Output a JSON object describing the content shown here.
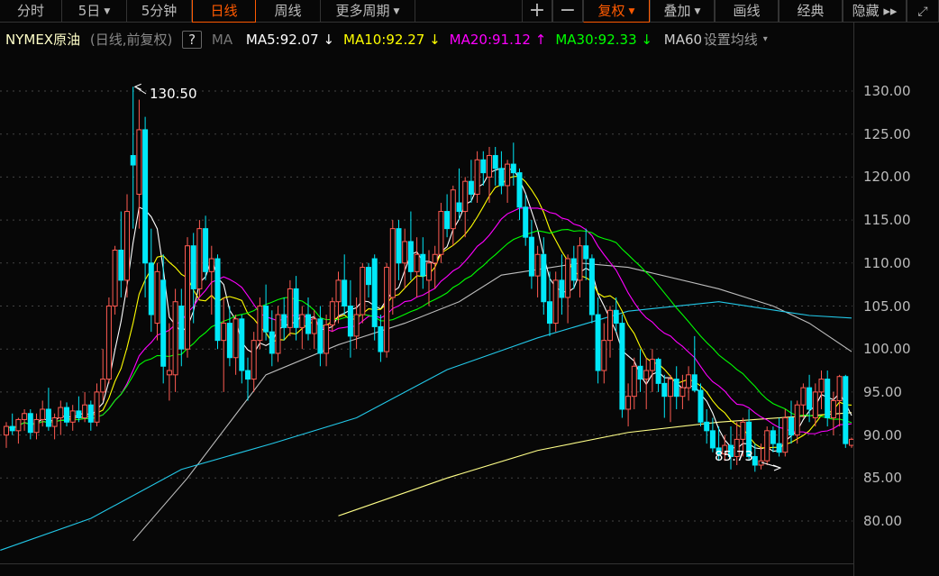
{
  "toolbar": {
    "left": [
      {
        "label": "分时"
      },
      {
        "label": "5日",
        "dropdown": true
      },
      {
        "label": "5分钟"
      },
      {
        "label": "日线",
        "active": true
      },
      {
        "label": "周线"
      },
      {
        "label": "更多周期",
        "dropdown": true
      }
    ],
    "zoom_in": "+",
    "zoom_out": "−",
    "right": [
      {
        "label": "复权",
        "dropdown": true,
        "active": true
      },
      {
        "label": "叠加",
        "dropdown": true
      },
      {
        "label": "画线"
      },
      {
        "label": "经典"
      },
      {
        "label": "隐藏 ▸▸"
      }
    ],
    "fullscreen_icon": "expand-icon"
  },
  "legend": {
    "symbol": "NYMEX原油",
    "period": "(日线,前复权)",
    "help": "?",
    "ma_label": "MA",
    "ma": [
      {
        "label": "MA5:92.07",
        "arrow": "↓",
        "color": "#ffffff"
      },
      {
        "label": "MA10:92.27",
        "arrow": "↓",
        "color": "#ffff00"
      },
      {
        "label": "MA20:91.12",
        "arrow": "↑",
        "color": "#ff00ff"
      },
      {
        "label": "MA30:92.33",
        "arrow": "↓",
        "color": "#00ff00"
      }
    ],
    "ma60": "MA60",
    "settings": "设置均线",
    "settings_arrow": "▾"
  },
  "colors": {
    "up": "#ff5b52",
    "down": "#00e8f8",
    "accent": "#ff5a00"
  },
  "chart_data": {
    "type": "candlestick",
    "ylim": [
      75,
      135
    ],
    "yticks": [
      "130.00",
      "125.00",
      "120.00",
      "115.00",
      "110.00",
      "105.00",
      "100.00",
      "95.00",
      "90.00",
      "85.00",
      "80.00"
    ],
    "annotations": {
      "high": "130.50",
      "low": "85.73"
    },
    "candles": [
      [
        90,
        91.5,
        88.5,
        91
      ],
      [
        91,
        92.5,
        90,
        90.5
      ],
      [
        90.5,
        92,
        89,
        91.8
      ],
      [
        91.8,
        93,
        90.5,
        92.5
      ],
      [
        92.5,
        93,
        89.5,
        90.3
      ],
      [
        90.3,
        92.5,
        89.5,
        91.8
      ],
      [
        91.8,
        94,
        91,
        93
      ],
      [
        93,
        95.5,
        90.5,
        91
      ],
      [
        91,
        92.5,
        89.5,
        92
      ],
      [
        92,
        94,
        90,
        93.2
      ],
      [
        93.2,
        93.8,
        91,
        91.5
      ],
      [
        91.5,
        93.5,
        90.5,
        92.8
      ],
      [
        92.8,
        94.5,
        91.5,
        92
      ],
      [
        92,
        95,
        91.5,
        93.5
      ],
      [
        93.5,
        94,
        90.5,
        91.5
      ],
      [
        91.5,
        96,
        91,
        95
      ],
      [
        95,
        100,
        94,
        96.5
      ],
      [
        96.5,
        106,
        96,
        105
      ],
      [
        105,
        112,
        104,
        111.5
      ],
      [
        111.5,
        116,
        106,
        108
      ],
      [
        108,
        118,
        106,
        116
      ],
      [
        122.5,
        130.5,
        114,
        121.4
      ],
      [
        118,
        129,
        114,
        125.5
      ],
      [
        125.5,
        127,
        106,
        110
      ],
      [
        110,
        114,
        102,
        104
      ],
      [
        103,
        110,
        101,
        109
      ],
      [
        108,
        111,
        96,
        98
      ],
      [
        97,
        103,
        94,
        97.5
      ],
      [
        97,
        107,
        95,
        105.5
      ],
      [
        105,
        107,
        98,
        100
      ],
      [
        100,
        113,
        99,
        112
      ],
      [
        112,
        113.5,
        103,
        107
      ],
      [
        107,
        115,
        106,
        114
      ],
      [
        114,
        115.5,
        108,
        109
      ],
      [
        109,
        112,
        104,
        110.5
      ],
      [
        110.5,
        111,
        100,
        101
      ],
      [
        101,
        106,
        95,
        103
      ],
      [
        103,
        105,
        98,
        99
      ],
      [
        99,
        104,
        97,
        103.5
      ],
      [
        103.5,
        104,
        96,
        97.5
      ],
      [
        97.5,
        99,
        94,
        96.5
      ],
      [
        96.5,
        102,
        95,
        101
      ],
      [
        101,
        106,
        100,
        105
      ],
      [
        105,
        107.5,
        101,
        102
      ],
      [
        102,
        104.5,
        98,
        99.5
      ],
      [
        99.5,
        105,
        98.5,
        104
      ],
      [
        104,
        106,
        101,
        102.5
      ],
      [
        102.5,
        108,
        101.5,
        107
      ],
      [
        107,
        108.5,
        101,
        102.5
      ],
      [
        102.5,
        105,
        100,
        104
      ],
      [
        104,
        106,
        101,
        101.8
      ],
      [
        101.8,
        104.5,
        100,
        103.5
      ],
      [
        103.5,
        105,
        98,
        99.5
      ],
      [
        99.5,
        104,
        98,
        102.8
      ],
      [
        102.8,
        106,
        102,
        105.5
      ],
      [
        105.5,
        109,
        103,
        108
      ],
      [
        108,
        111,
        104,
        105
      ],
      [
        105,
        108,
        99,
        101.5
      ],
      [
        101.5,
        106,
        100,
        104
      ],
      [
        104,
        110,
        103,
        109.5
      ],
      [
        109.5,
        110,
        106,
        107.5
      ],
      [
        110.5,
        111,
        101,
        102.6
      ],
      [
        102.6,
        104,
        98.5,
        99.7
      ],
      [
        99.7,
        110,
        99,
        109.5
      ],
      [
        106,
        115,
        104,
        114
      ],
      [
        114,
        115,
        108,
        110
      ],
      [
        110,
        114,
        107,
        112.5
      ],
      [
        112.5,
        116,
        108,
        109
      ],
      [
        109,
        113,
        106,
        111
      ],
      [
        111,
        113,
        107,
        108.5
      ],
      [
        108,
        111.5,
        105,
        110
      ],
      [
        110,
        112,
        107,
        111
      ],
      [
        111,
        117,
        110,
        116
      ],
      [
        116,
        118,
        113,
        114
      ],
      [
        114,
        119,
        112,
        118.5
      ],
      [
        117,
        121,
        115,
        116
      ],
      [
        116,
        120,
        113,
        119.5
      ],
      [
        119.5,
        122,
        117,
        118
      ],
      [
        118,
        123,
        117,
        122
      ],
      [
        122,
        123,
        119,
        120.5
      ],
      [
        120,
        123.5,
        117,
        122.5
      ],
      [
        122.5,
        123.5,
        119,
        121
      ],
      [
        121,
        123,
        118,
        119
      ],
      [
        119,
        122,
        117,
        121.5
      ],
      [
        121.5,
        124,
        119,
        120.5
      ],
      [
        120.5,
        121,
        115,
        116.5
      ],
      [
        116.5,
        118,
        112,
        113
      ],
      [
        113,
        115,
        107,
        108.5
      ],
      [
        108.5,
        112,
        106,
        111
      ],
      [
        111,
        113,
        104,
        105.5
      ],
      [
        105.5,
        109,
        101.5,
        103
      ],
      [
        103,
        109,
        102,
        108
      ],
      [
        108,
        111,
        104,
        106
      ],
      [
        106,
        111,
        103,
        110.5
      ],
      [
        110.5,
        112,
        107,
        108
      ],
      [
        108,
        113,
        106,
        112
      ],
      [
        112,
        114,
        108,
        110.5
      ],
      [
        110.5,
        111,
        103,
        104
      ],
      [
        104,
        106,
        96,
        97.5
      ],
      [
        97.5,
        103,
        96,
        101
      ],
      [
        101,
        105,
        99,
        104.5
      ],
      [
        104.5,
        106,
        102,
        103
      ],
      [
        103,
        104,
        92,
        93
      ],
      [
        93,
        96,
        91,
        94.5
      ],
      [
        94.5,
        99,
        93,
        98
      ],
      [
        98,
        100,
        95,
        96.5
      ],
      [
        96.5,
        99,
        93,
        97.5
      ],
      [
        97.5,
        100,
        95,
        98.8
      ],
      [
        98.8,
        99,
        95,
        96
      ],
      [
        96,
        97,
        92,
        94.5
      ],
      [
        94.5,
        97,
        91.5,
        96.5
      ],
      [
        96.5,
        98,
        93,
        94.5
      ],
      [
        94.5,
        97,
        93,
        95.5
      ],
      [
        95.5,
        98,
        94,
        97
      ],
      [
        97,
        101.5,
        95,
        95.2
      ],
      [
        95.2,
        96,
        91,
        91.5
      ],
      [
        91.5,
        93,
        89,
        90.5
      ],
      [
        90.5,
        92,
        88,
        88.5
      ],
      [
        88.5,
        91,
        87,
        87.8
      ],
      [
        87.8,
        90,
        87,
        88.8
      ],
      [
        88.8,
        91,
        86,
        87.5
      ],
      [
        87.5,
        91.5,
        86.5,
        89.5
      ],
      [
        89.5,
        92,
        87.5,
        91.5
      ],
      [
        91.5,
        93,
        87,
        87.5
      ],
      [
        87.5,
        89,
        85.73,
        86.5
      ],
      [
        86.5,
        89,
        86,
        87
      ],
      [
        87,
        91,
        86.5,
        90.5
      ],
      [
        90.5,
        91,
        88,
        89
      ],
      [
        89,
        92,
        87.5,
        88
      ],
      [
        88,
        93,
        87.5,
        92
      ],
      [
        92,
        94,
        89,
        90
      ],
      [
        90,
        94,
        89,
        93.5
      ],
      [
        93.5,
        96,
        92,
        95.5
      ],
      [
        95.5,
        97,
        91.5,
        93
      ],
      [
        92,
        96,
        91,
        95
      ],
      [
        95,
        97.5,
        93,
        96.5
      ],
      [
        96.5,
        97.5,
        91,
        92
      ],
      [
        92,
        95,
        90,
        94
      ],
      [
        94,
        97,
        91,
        96.8
      ],
      [
        96.8,
        97,
        88.5,
        89
      ],
      [
        88.8,
        89.7,
        88.5,
        89.5
      ]
    ],
    "ma_computed": [
      {
        "name": "MA5",
        "period": 5,
        "color": "#ffffff"
      },
      {
        "name": "MA10",
        "period": 10,
        "color": "#ffff00"
      },
      {
        "name": "MA20",
        "period": 20,
        "color": "#ff00ff"
      },
      {
        "name": "MA30",
        "period": 30,
        "color": "#00ff00"
      }
    ],
    "ma_long": [
      {
        "name": "MA60",
        "color": "#bdbdbd",
        "points": [
          [
            21,
            77.7
          ],
          [
            30,
            85
          ],
          [
            43,
            97
          ],
          [
            55,
            100.5
          ],
          [
            66,
            103
          ],
          [
            75,
            105.5
          ],
          [
            82,
            108.6
          ],
          [
            95,
            110
          ],
          [
            103,
            109.5
          ],
          [
            118,
            107
          ],
          [
            127,
            105
          ],
          [
            133,
            103
          ],
          [
            140,
            99.7
          ]
        ]
      },
      {
        "name": "MA120",
        "color": "#22c8e8",
        "points": [
          [
            -1,
            76.6
          ],
          [
            14,
            80.3
          ],
          [
            29,
            86
          ],
          [
            44,
            89
          ],
          [
            58,
            92
          ],
          [
            73,
            97.6
          ],
          [
            88,
            101.3
          ],
          [
            103,
            104.4
          ],
          [
            118,
            105.5
          ],
          [
            133,
            103.9
          ],
          [
            140,
            103.6
          ]
        ]
      },
      {
        "name": "MA250",
        "color": "#ffff88",
        "points": [
          [
            55,
            80.6
          ],
          [
            73,
            85
          ],
          [
            88,
            88.2
          ],
          [
            103,
            90.3
          ],
          [
            118,
            91.5
          ],
          [
            140,
            92.6
          ]
        ]
      }
    ]
  }
}
